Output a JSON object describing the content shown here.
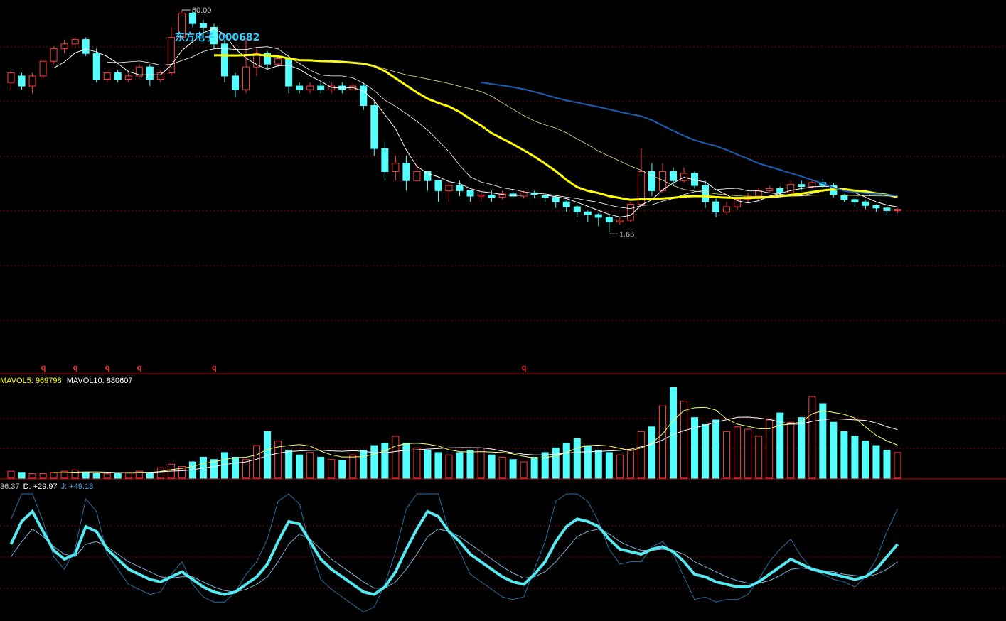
{
  "stock": {
    "name": "东方电子",
    "code": "000682"
  },
  "colors": {
    "up": "#ff3b3b",
    "down": "#54ffff",
    "ma_thin": "#ffffff",
    "ma_yellow": "#ffff00",
    "ma_blue": "#1a5fb4",
    "grid": "#8b0000",
    "kdj_j": "#2a6f9f"
  },
  "price_panel": {
    "high_label": "60.00",
    "low_label": "1.66",
    "marker_glyph": "q"
  },
  "volume_panel": {
    "mavol5_label": "MAVOL5:",
    "mavol5_value": "969798",
    "mavol10_label": "MAVOL10:",
    "mavol10_value": "880607"
  },
  "kdj_panel": {
    "k_value": "36.37",
    "d_label": "D:",
    "d_value": "+29.97",
    "j_label": "J:",
    "j_value": "+49.18"
  },
  "chart_data": {
    "type": "candlestick",
    "panels": [
      "price",
      "volume",
      "kdj"
    ],
    "price_high": 60.0,
    "price_low": 1.66,
    "candles": [
      [
        28,
        31,
        26,
        32
      ],
      [
        30,
        27,
        26,
        31
      ],
      [
        27,
        30,
        25,
        31
      ],
      [
        30,
        35,
        29,
        36
      ],
      [
        35,
        40,
        34,
        41
      ],
      [
        40,
        42,
        38,
        44
      ],
      [
        42,
        44,
        40,
        45
      ],
      [
        44,
        38,
        37,
        45
      ],
      [
        38,
        29,
        28,
        40
      ],
      [
        29,
        31,
        28,
        32
      ],
      [
        31,
        29,
        28,
        32
      ],
      [
        29,
        30,
        28,
        31
      ],
      [
        30,
        33,
        29,
        34
      ],
      [
        33,
        29,
        27,
        34
      ],
      [
        29,
        31,
        28,
        32
      ],
      [
        31,
        45,
        30,
        50
      ],
      [
        45,
        58,
        44,
        60
      ],
      [
        58,
        52,
        50,
        59
      ],
      [
        52,
        50,
        45,
        54
      ],
      [
        50,
        42,
        40,
        52
      ],
      [
        42,
        30,
        28,
        44
      ],
      [
        30,
        26,
        24,
        31
      ],
      [
        26,
        33,
        25,
        45
      ],
      [
        33,
        38,
        30,
        40
      ],
      [
        38,
        34,
        32,
        39
      ],
      [
        34,
        36,
        33,
        37
      ],
      [
        36,
        27,
        25,
        37
      ],
      [
        27,
        26,
        25,
        28
      ],
      [
        26,
        27,
        25,
        28
      ],
      [
        27,
        26,
        25,
        28
      ],
      [
        26,
        27,
        25,
        28
      ],
      [
        27,
        26,
        25,
        28
      ],
      [
        26,
        27,
        26,
        28
      ],
      [
        27,
        22,
        21,
        28
      ],
      [
        22,
        14,
        13,
        23
      ],
      [
        14,
        11,
        10,
        15
      ],
      [
        11,
        12,
        10,
        13
      ],
      [
        12,
        10,
        9,
        13
      ],
      [
        10,
        11,
        10,
        12
      ],
      [
        11,
        10,
        9,
        11
      ],
      [
        10,
        9,
        8,
        10
      ],
      [
        9,
        9.5,
        8,
        10
      ],
      [
        9.5,
        9,
        8.5,
        10
      ],
      [
        9,
        8.5,
        8,
        9
      ],
      [
        8.5,
        8.6,
        8,
        9
      ],
      [
        8.6,
        8.4,
        8,
        9
      ],
      [
        8.4,
        8.7,
        8.2,
        9
      ],
      [
        8.7,
        8.5,
        8.3,
        8.9
      ],
      [
        8.5,
        8.8,
        8.3,
        9
      ],
      [
        8.8,
        8.6,
        8.3,
        9
      ],
      [
        8.6,
        8.4,
        8,
        8.7
      ],
      [
        8.4,
        8,
        7.5,
        8.5
      ],
      [
        8,
        7.6,
        7.2,
        8.1
      ],
      [
        7.6,
        7.2,
        6.8,
        7.7
      ],
      [
        7.2,
        7,
        6.5,
        7.3
      ],
      [
        7,
        6.8,
        6.2,
        7.1
      ],
      [
        6.8,
        6.5,
        5.8,
        7
      ],
      [
        6.5,
        6.6,
        6.3,
        6.8
      ],
      [
        6.6,
        7.8,
        6.5,
        8
      ],
      [
        7.8,
        11,
        7.5,
        14
      ],
      [
        11,
        9,
        8.5,
        12
      ],
      [
        9,
        11,
        8.8,
        12
      ],
      [
        11,
        10,
        9.5,
        11.5
      ],
      [
        10,
        10.8,
        9.8,
        11.5
      ],
      [
        10.8,
        9.5,
        9.2,
        11
      ],
      [
        9.5,
        8,
        7.5,
        10
      ],
      [
        8,
        7.2,
        6.8,
        8.3
      ],
      [
        7.2,
        7.6,
        7,
        8
      ],
      [
        7.6,
        8.2,
        7.4,
        8.5
      ],
      [
        8.2,
        8.5,
        8,
        8.8
      ],
      [
        8.5,
        9,
        8.2,
        9.3
      ],
      [
        9,
        9.2,
        8.8,
        9.5
      ],
      [
        9.2,
        8.8,
        8.5,
        9.4
      ],
      [
        8.8,
        9.6,
        8.6,
        10
      ],
      [
        9.6,
        9.4,
        9,
        10
      ],
      [
        9.4,
        9.8,
        9.2,
        10
      ],
      [
        9.8,
        9.5,
        9.2,
        10.2
      ],
      [
        9.5,
        8.6,
        8.4,
        9.8
      ],
      [
        8.6,
        8.2,
        8,
        8.7
      ],
      [
        8.2,
        8,
        7.6,
        8.4
      ],
      [
        8,
        7.7,
        7.4,
        8.1
      ],
      [
        7.7,
        7.5,
        7.2,
        7.8
      ],
      [
        7.5,
        7.3,
        7,
        7.6
      ],
      [
        7.3,
        7.4,
        7.1,
        7.5
      ]
    ],
    "volumes": [
      6,
      5,
      4,
      4,
      5,
      6,
      7,
      5,
      4,
      4,
      4,
      5,
      6,
      5,
      9,
      12,
      10,
      14,
      18,
      16,
      22,
      18,
      16,
      28,
      40,
      32,
      24,
      20,
      22,
      18,
      16,
      15,
      20,
      24,
      28,
      30,
      36,
      30,
      26,
      24,
      22,
      20,
      22,
      24,
      26,
      20,
      18,
      16,
      14,
      18,
      22,
      26,
      30,
      34,
      28,
      24,
      22,
      20,
      24,
      40,
      44,
      62,
      78,
      66,
      52,
      46,
      50,
      40,
      44,
      42,
      36,
      50,
      56,
      48,
      52,
      70,
      64,
      48,
      40,
      36,
      32,
      28,
      24,
      22
    ],
    "kdj": [
      {
        "name": "K",
        "values": [
          60,
          78,
          86,
          70,
          55,
          48,
          52,
          74,
          70,
          56,
          48,
          40,
          36,
          32,
          30,
          34,
          38,
          32,
          26,
          22,
          20,
          22,
          28,
          34,
          44,
          62,
          78,
          76,
          62,
          48,
          40,
          34,
          28,
          22,
          20,
          26,
          38,
          56,
          72,
          86,
          82,
          70,
          62,
          52,
          46,
          40,
          34,
          30,
          28,
          36,
          46,
          62,
          74,
          80,
          78,
          74,
          64,
          56,
          54,
          52,
          56,
          58,
          54,
          46,
          36,
          34,
          30,
          28,
          26,
          26,
          30,
          36,
          42,
          48,
          44,
          40,
          38,
          36,
          34,
          32,
          34,
          40,
          50,
          60
        ]
      },
      {
        "name": "D",
        "values": [
          50,
          62,
          72,
          66,
          58,
          52,
          50,
          60,
          62,
          58,
          52,
          46,
          42,
          38,
          34,
          33,
          34,
          34,
          30,
          26,
          23,
          22,
          24,
          28,
          34,
          46,
          60,
          68,
          64,
          56,
          48,
          42,
          36,
          30,
          25,
          25,
          30,
          40,
          52,
          66,
          72,
          70,
          66,
          60,
          54,
          48,
          42,
          37,
          33,
          34,
          38,
          46,
          56,
          66,
          70,
          72,
          68,
          62,
          58,
          55,
          55,
          56,
          55,
          52,
          46,
          42,
          38,
          34,
          31,
          29,
          29,
          31,
          35,
          40,
          41,
          40,
          39,
          38,
          36,
          35,
          34,
          36,
          40,
          46
        ]
      },
      {
        "name": "J",
        "values": [
          80,
          100,
          100,
          78,
          50,
          40,
          56,
          96,
          86,
          52,
          40,
          28,
          24,
          20,
          22,
          36,
          46,
          28,
          18,
          14,
          14,
          22,
          36,
          46,
          64,
          94,
          100,
          92,
          58,
          32,
          24,
          18,
          12,
          6,
          10,
          28,
          54,
          88,
          100,
          100,
          100,
          70,
          54,
          36,
          30,
          24,
          18,
          16,
          18,
          40,
          62,
          94,
          100,
          100,
          94,
          78,
          56,
          44,
          46,
          46,
          58,
          62,
          52,
          34,
          16,
          18,
          14,
          16,
          16,
          20,
          32,
          46,
          56,
          64,
          50,
          40,
          36,
          32,
          30,
          26,
          34,
          48,
          70,
          88
        ]
      }
    ]
  }
}
